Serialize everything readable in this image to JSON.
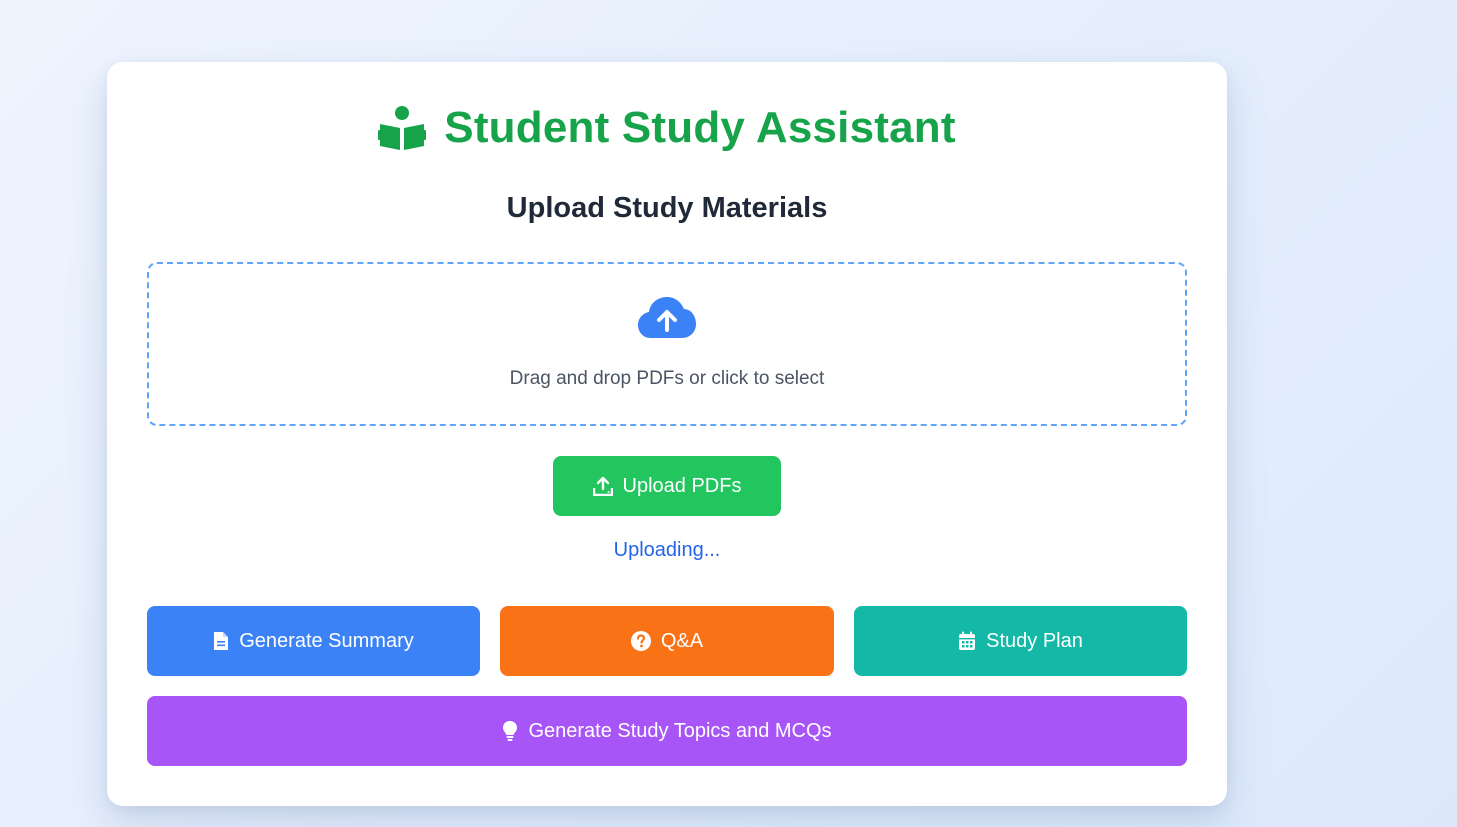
{
  "app": {
    "title": "Student Study Assistant",
    "title_icon": "book-reader-icon",
    "accent_color": "#16a34a"
  },
  "upload_section": {
    "heading": "Upload Study Materials",
    "dropzone_icon": "cloud-upload-icon",
    "dropzone_text": "Drag and drop PDFs or click to select",
    "upload_button": {
      "label": "Upload PDFs",
      "icon": "upload-icon",
      "color": "#22c55e"
    },
    "status": "Uploading..."
  },
  "actions": {
    "summary": {
      "label": "Generate Summary",
      "icon": "file-icon",
      "color": "#3b82f6"
    },
    "qa": {
      "label": "Q&A",
      "icon": "question-circle-icon",
      "color": "#f97316"
    },
    "plan": {
      "label": "Study Plan",
      "icon": "calendar-icon",
      "color": "#14b8a6"
    },
    "topics": {
      "label": "Generate Study Topics and MCQs",
      "icon": "lightbulb-icon",
      "color": "#a855f7"
    }
  }
}
